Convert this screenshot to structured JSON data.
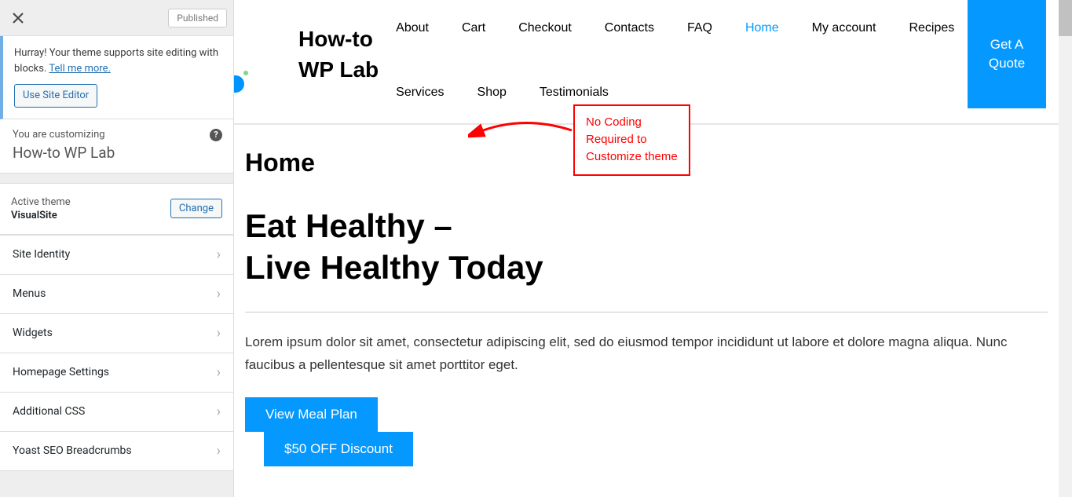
{
  "topbar": {
    "status": "Published"
  },
  "notice": {
    "text_a": "Hurray! Your theme supports site editing with blocks. ",
    "link": "Tell me more.",
    "button": "Use Site Editor"
  },
  "context": {
    "label": "You are customizing",
    "title": "How-to WP Lab"
  },
  "theme": {
    "label": "Active theme",
    "name": "VisualSite",
    "change": "Change"
  },
  "sections": [
    "Site Identity",
    "Menus",
    "Widgets",
    "Homepage Settings",
    "Additional CSS",
    "Yoast SEO Breadcrumbs"
  ],
  "site": {
    "title_line1": "How-to",
    "title_line2": "WP Lab",
    "nav": [
      "About",
      "Cart",
      "Checkout",
      "Contacts",
      "FAQ",
      "Home",
      "My account",
      "Recipes",
      "Services",
      "Shop",
      "Testimonials"
    ],
    "active_nav": "Home",
    "cta": "Get A Quote"
  },
  "annotation": {
    "l1": "No Coding",
    "l2": "Required to",
    "l3": "Customize theme"
  },
  "page": {
    "title": "Home",
    "hero1": "Eat Healthy –",
    "hero2": "Live Healthy Today",
    "lead": "Lorem ipsum dolor sit amet, consectetur adipiscing elit, sed do eiusmod tempor incididunt ut labore et dolore magna aliqua. Nunc faucibus a pellentesque sit amet porttitor eget.",
    "btn1": "View Meal Plan",
    "btn2": "$50 OFF Discount"
  }
}
